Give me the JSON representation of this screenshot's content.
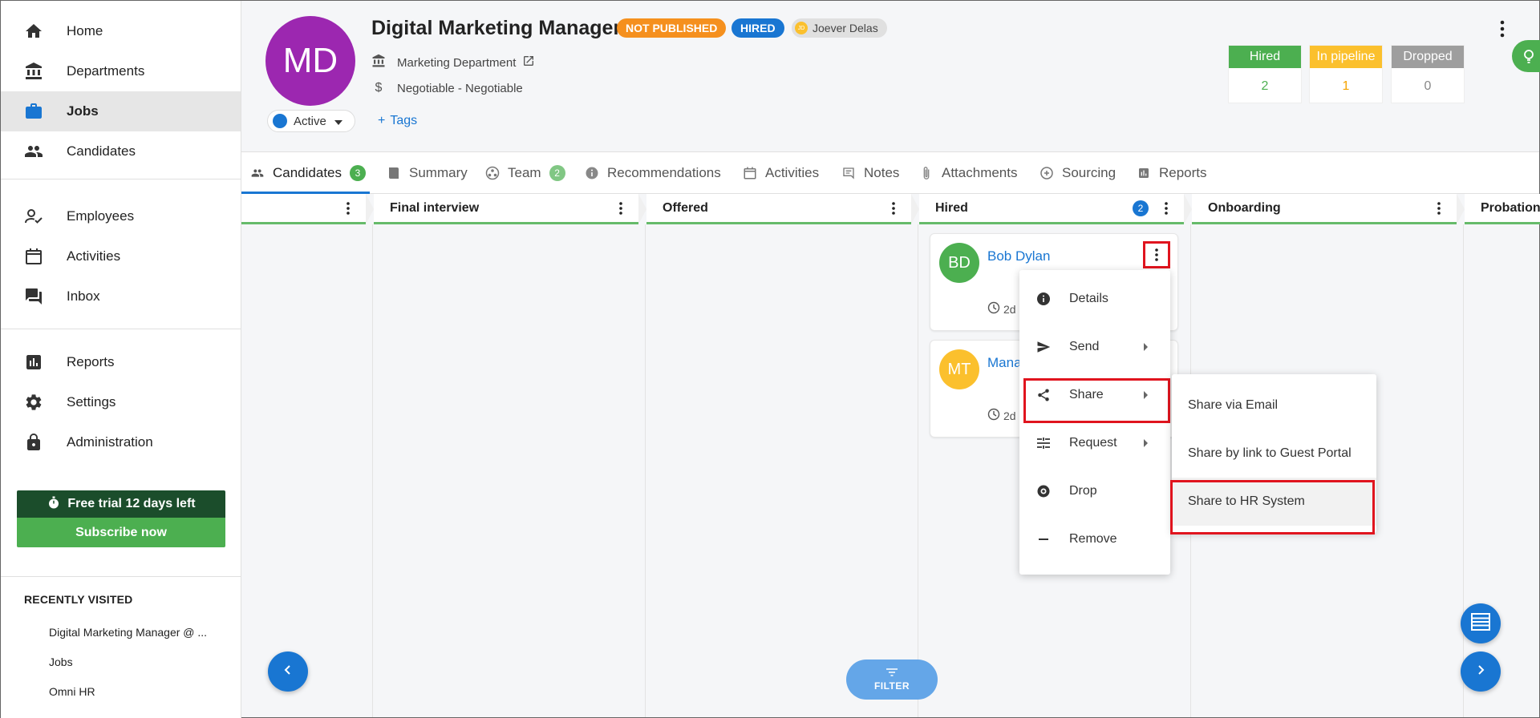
{
  "sidebar": {
    "items": [
      {
        "label": "Home",
        "icon": "home-icon"
      },
      {
        "label": "Departments",
        "icon": "bank-icon"
      },
      {
        "label": "Jobs",
        "icon": "briefcase-icon",
        "active": true
      },
      {
        "label": "Candidates",
        "icon": "people-icon"
      },
      {
        "label": "Employees",
        "icon": "person-check-icon"
      },
      {
        "label": "Activities",
        "icon": "calendar-icon"
      },
      {
        "label": "Inbox",
        "icon": "chat-icon"
      },
      {
        "label": "Reports",
        "icon": "bar-chart-icon"
      },
      {
        "label": "Settings",
        "icon": "gear-icon"
      },
      {
        "label": "Administration",
        "icon": "lock-icon"
      }
    ],
    "trial": {
      "text": "Free trial 12 days left",
      "cta": "Subscribe now"
    },
    "recent_title": "RECENTLY VISITED",
    "recent": [
      "Digital Marketing Manager @ ...",
      "Jobs",
      "Omni HR"
    ]
  },
  "job": {
    "initials": "MD",
    "title": "Digital Marketing Manager",
    "badges": [
      "NOT PUBLISHED",
      "HIRED"
    ],
    "owner_initials": "JD",
    "owner": "Joever Delas",
    "department": "Marketing Department",
    "salary": "Negotiable - Negotiable",
    "status": "Active",
    "tags_label": "Tags"
  },
  "stats": [
    {
      "label": "Hired",
      "value": "2",
      "color": "#4caf50"
    },
    {
      "label": "In pipeline",
      "value": "1",
      "color": "#fbc02d"
    },
    {
      "label": "Dropped",
      "value": "0",
      "color": "#9e9e9e"
    }
  ],
  "tabs": [
    {
      "label": "Candidates",
      "count": "3",
      "icon": "people-icon"
    },
    {
      "label": "Summary",
      "icon": "book-icon"
    },
    {
      "label": "Team",
      "count": "2",
      "icon": "team-icon"
    },
    {
      "label": "Recommendations",
      "icon": "info-icon"
    },
    {
      "label": "Activities",
      "icon": "calendar-icon"
    },
    {
      "label": "Notes",
      "icon": "note-icon"
    },
    {
      "label": "Attachments",
      "icon": "paperclip-icon"
    },
    {
      "label": "Sourcing",
      "icon": "sourcing-icon"
    },
    {
      "label": "Reports",
      "icon": "report-icon"
    }
  ],
  "columns": [
    {
      "name": ""
    },
    {
      "name": "Final interview"
    },
    {
      "name": "Offered"
    },
    {
      "name": "Hired",
      "count": "2"
    },
    {
      "name": "Onboarding"
    },
    {
      "name": "Probation"
    }
  ],
  "cards": [
    {
      "initials": "BD",
      "name": "Bob Dylan",
      "time": "2d",
      "color": "#4caf50"
    },
    {
      "initials": "MT",
      "name": "Mana",
      "time": "2d",
      "color": "#fbc02d"
    }
  ],
  "context_menu": [
    {
      "label": "Details",
      "icon": "info-icon"
    },
    {
      "label": "Send",
      "icon": "send-icon",
      "submenu": true
    },
    {
      "label": "Share",
      "icon": "share-icon",
      "submenu": true
    },
    {
      "label": "Request",
      "icon": "request-icon",
      "submenu": true
    },
    {
      "label": "Drop",
      "icon": "drop-icon"
    },
    {
      "label": "Remove",
      "icon": "minus-icon"
    }
  ],
  "share_menu": [
    "Share via Email",
    "Share by link to Guest Portal",
    "Share to HR System"
  ],
  "filter_label": "FILTER"
}
